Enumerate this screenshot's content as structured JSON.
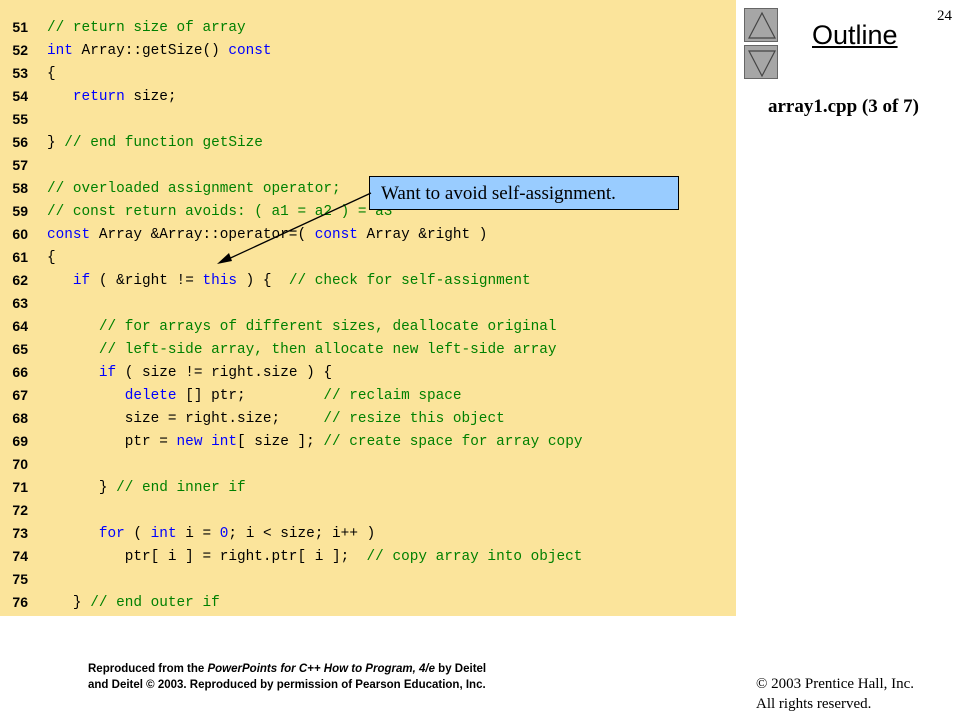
{
  "slide_number": "24",
  "outline_label": "Outline",
  "file_label": "array1.cpp (3 of 7)",
  "nav": {
    "up_icon": "triangle-up-icon",
    "down_icon": "triangle-down-icon"
  },
  "callout": {
    "text": "Want to avoid self-assignment."
  },
  "colors": {
    "code_background": "#fbe49b",
    "keyword": "#0000ff",
    "comment": "#008000",
    "callout_background": "#99ccff",
    "button": "#a6a6a6"
  },
  "code_lines": [
    {
      "ln": "51",
      "tokens": [
        {
          "t": "// return size of array",
          "c": "cm"
        }
      ]
    },
    {
      "ln": "52",
      "tokens": [
        {
          "t": "int",
          "c": "kw"
        },
        {
          "t": " Array::getSize() "
        },
        {
          "t": "const",
          "c": "kw"
        }
      ]
    },
    {
      "ln": "53",
      "tokens": [
        {
          "t": "{"
        }
      ]
    },
    {
      "ln": "54",
      "tokens": [
        {
          "t": "   "
        },
        {
          "t": "return",
          "c": "kw"
        },
        {
          "t": " size;"
        }
      ]
    },
    {
      "ln": "55",
      "tokens": []
    },
    {
      "ln": "56",
      "tokens": [
        {
          "t": "} "
        },
        {
          "t": "// end function getSize",
          "c": "cm"
        }
      ]
    },
    {
      "ln": "57",
      "tokens": []
    },
    {
      "ln": "58",
      "tokens": [
        {
          "t": "// overloaded assignment operator;",
          "c": "cm"
        }
      ]
    },
    {
      "ln": "59",
      "tokens": [
        {
          "t": "// const return avoids: ( a1 = a2 ) = a3",
          "c": "cm"
        }
      ]
    },
    {
      "ln": "60",
      "tokens": [
        {
          "t": "const",
          "c": "kw"
        },
        {
          "t": " Array &Array::operator=( "
        },
        {
          "t": "const",
          "c": "kw"
        },
        {
          "t": " Array &right )"
        }
      ]
    },
    {
      "ln": "61",
      "tokens": [
        {
          "t": "{"
        }
      ]
    },
    {
      "ln": "62",
      "tokens": [
        {
          "t": "   "
        },
        {
          "t": "if",
          "c": "kw"
        },
        {
          "t": " ( &right != "
        },
        {
          "t": "this",
          "c": "kw"
        },
        {
          "t": " ) {  "
        },
        {
          "t": "// check for self-assignment",
          "c": "cm"
        }
      ]
    },
    {
      "ln": "63",
      "tokens": []
    },
    {
      "ln": "64",
      "tokens": [
        {
          "t": "      "
        },
        {
          "t": "// for arrays of different sizes, deallocate original",
          "c": "cm"
        }
      ]
    },
    {
      "ln": "65",
      "tokens": [
        {
          "t": "      "
        },
        {
          "t": "// left-side array, then allocate new left-side array",
          "c": "cm"
        }
      ]
    },
    {
      "ln": "66",
      "tokens": [
        {
          "t": "      "
        },
        {
          "t": "if",
          "c": "kw"
        },
        {
          "t": " ( size != right.size ) {"
        }
      ]
    },
    {
      "ln": "67",
      "tokens": [
        {
          "t": "         "
        },
        {
          "t": "delete",
          "c": "kw"
        },
        {
          "t": " [] ptr;         "
        },
        {
          "t": "// reclaim space",
          "c": "cm"
        }
      ]
    },
    {
      "ln": "68",
      "tokens": [
        {
          "t": "         size = right.size;     "
        },
        {
          "t": "// resize this object",
          "c": "cm"
        }
      ]
    },
    {
      "ln": "69",
      "tokens": [
        {
          "t": "         ptr = "
        },
        {
          "t": "new",
          "c": "kw"
        },
        {
          "t": " "
        },
        {
          "t": "int",
          "c": "kw"
        },
        {
          "t": "[ size ]; "
        },
        {
          "t": "// create space for array copy",
          "c": "cm"
        }
      ]
    },
    {
      "ln": "70",
      "tokens": []
    },
    {
      "ln": "71",
      "tokens": [
        {
          "t": "      } "
        },
        {
          "t": "// end inner if",
          "c": "cm"
        }
      ]
    },
    {
      "ln": "72",
      "tokens": []
    },
    {
      "ln": "73",
      "tokens": [
        {
          "t": "      "
        },
        {
          "t": "for",
          "c": "kw"
        },
        {
          "t": " ( "
        },
        {
          "t": "int",
          "c": "kw"
        },
        {
          "t": " i = "
        },
        {
          "t": "0",
          "c": "num"
        },
        {
          "t": "; i < size; i++ )"
        }
      ]
    },
    {
      "ln": "74",
      "tokens": [
        {
          "t": "         ptr[ i ] = right.ptr[ i ];  "
        },
        {
          "t": "// copy array into object",
          "c": "cm"
        }
      ]
    },
    {
      "ln": "75",
      "tokens": []
    },
    {
      "ln": "76",
      "tokens": [
        {
          "t": "   } "
        },
        {
          "t": "// end outer if",
          "c": "cm"
        }
      ]
    }
  ],
  "footer": {
    "line1_prefix": "Reproduced from the ",
    "line1_italic": "PowerPoints for C++ How to Program, 4/e",
    "line1_suffix": " by Deitel",
    "line2": "and Deitel © 2003. Reproduced by permission of Pearson Education, Inc."
  },
  "copyright": {
    "line1": "© 2003 Prentice Hall, Inc.",
    "line2": "All rights reserved."
  }
}
